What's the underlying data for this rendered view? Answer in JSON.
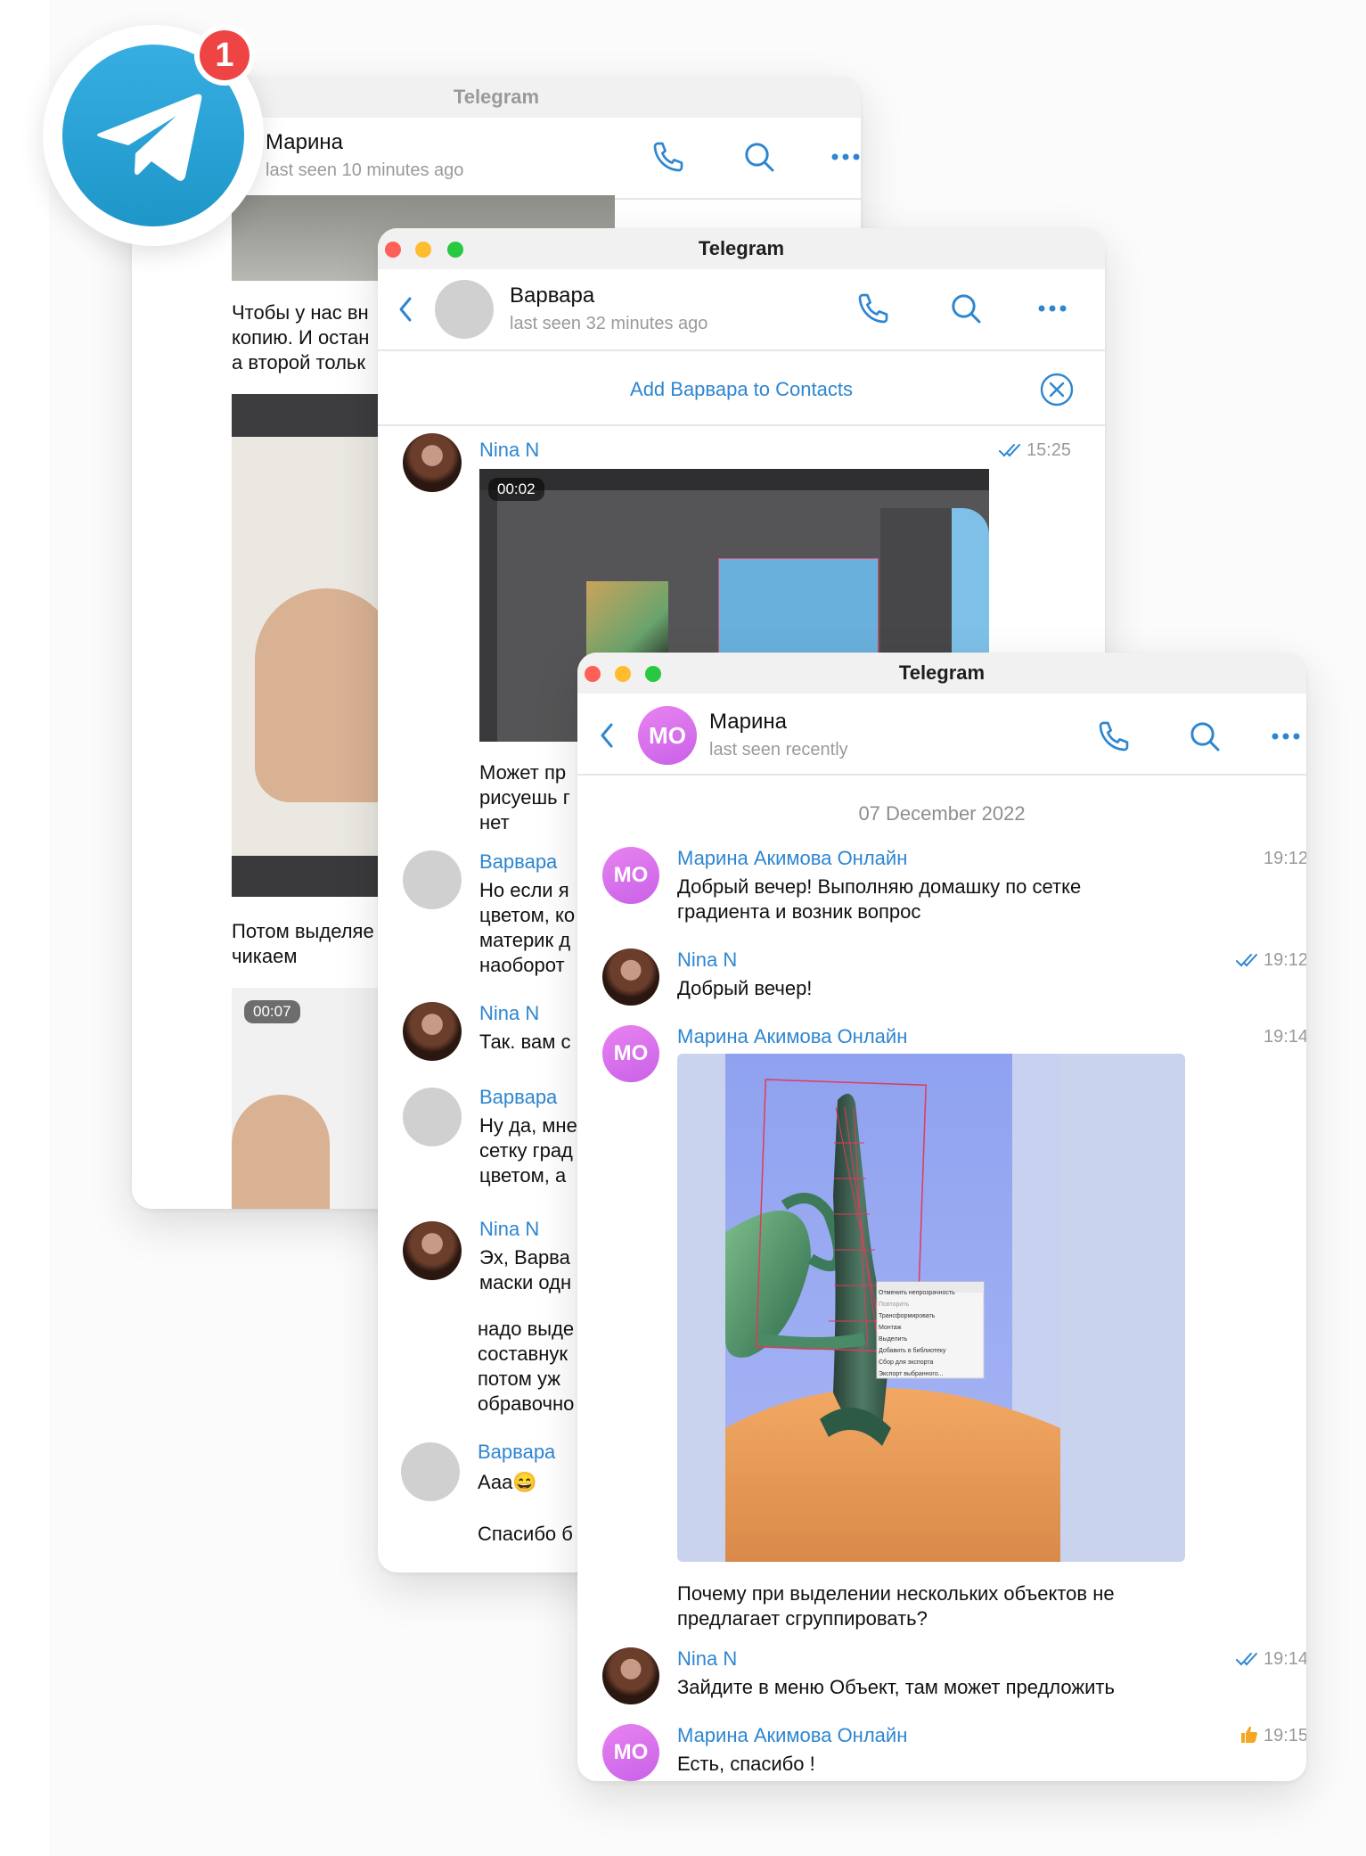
{
  "brand": {
    "badge_count": "1",
    "accent": "#2aa3e0",
    "badge_color": "#ef4444"
  },
  "win1": {
    "title": "Telegram",
    "name": "Марина",
    "status": "last seen 10 minutes ago",
    "msg1": [
      "Чтобы у нас вн",
      "копию. И остан",
      "а второй тольк"
    ],
    "msg2": [
      "Потом выделяе",
      "чикаем"
    ],
    "video_time": "00:07"
  },
  "win2": {
    "title": "Telegram",
    "name": "Варвара",
    "status": "last seen 32 minutes ago",
    "add_contact": "Add Варвара to Contacts",
    "messages": [
      {
        "sender": "Nina N",
        "time": "15:25",
        "video_time": "00:02"
      },
      {
        "lines": [
          "Может пр",
          "рисуешь г",
          "нет"
        ]
      },
      {
        "sender": "Варвара",
        "lines": [
          "Но если я",
          "цветом, ко",
          "материк д",
          "наоборот"
        ]
      },
      {
        "sender": "Nina N",
        "lines": [
          "Так. вам с"
        ]
      },
      {
        "sender": "Варвара",
        "lines": [
          "Ну да, мне",
          "сетку град",
          "цветом, а"
        ]
      },
      {
        "sender": "Nina N",
        "lines": [
          "Эх, Варва",
          "маски одн"
        ]
      },
      {
        "lines": [
          "надо выде",
          "составнук",
          "потом уж",
          "обравочно"
        ]
      },
      {
        "sender": "Варвара",
        "lines": [
          "Ааа😄"
        ]
      },
      {
        "lines": [
          "Спасибо б"
        ]
      }
    ]
  },
  "win3": {
    "title": "Telegram",
    "name": "Марина",
    "avatar_initials": "МО",
    "status": "last seen recently",
    "date": "07 December 2022",
    "messages": [
      {
        "sender": "Марина Акимова Онлайн",
        "time": "19:12",
        "lines": [
          "Добрый вечер! Выполняю домашку по сетке",
          "градиента и возник вопрос"
        ]
      },
      {
        "sender": "Nina N",
        "time": "19:12",
        "lines": [
          "Добрый вечер!"
        ]
      },
      {
        "sender": "Марина Акимова Онлайн",
        "time": "19:14",
        "lines": [
          "Почему при выделении нескольких объектов не",
          "предлагает сгруппировать?"
        ]
      },
      {
        "sender": "Nina N",
        "time": "19:14",
        "lines": [
          "Зайдите в меню Объект, там может предложить"
        ]
      },
      {
        "sender": "Марина Акимова Онлайн",
        "time": "19:15",
        "lines": [
          "Есть, спасибо !"
        ]
      }
    ],
    "context_menu": [
      "Отменить непрозрачность",
      "Повторить",
      "Трансформировать",
      "Монтаж",
      "Выделить",
      "Добавить в библиотеку",
      "Сбор для экспорта",
      "Экспорт выбранного..."
    ]
  }
}
